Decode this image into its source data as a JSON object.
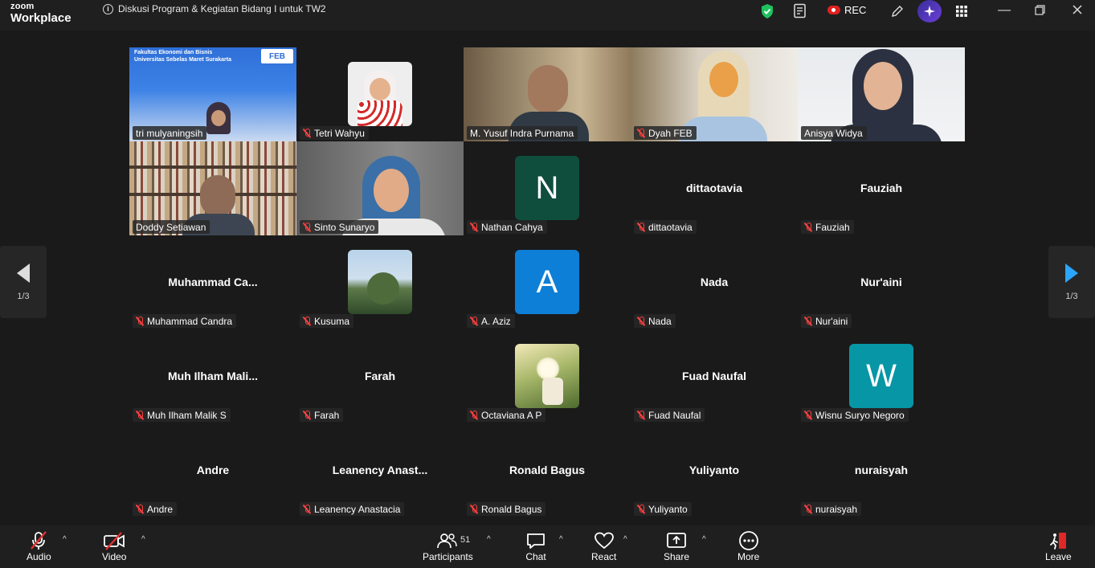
{
  "app": {
    "logo_line1": "zoom",
    "logo_line2": "Workplace"
  },
  "meeting": {
    "title": "Diskusi Program & Kegiatan Bidang I untuk TW2",
    "rec_label": "REC"
  },
  "pager": {
    "page": "1/3"
  },
  "feb_banner": {
    "line1": "Fakultas Ekonomi dan Bisnis",
    "line2": "Universitas Sebelas Maret Surakarta",
    "logo": "FEB"
  },
  "tiles": [
    {
      "name": "tri mulyaningsih",
      "kind": "video"
    },
    {
      "name": "Tetri Wahyu",
      "kind": "thumb"
    },
    {
      "name": "M. Yusuf Indra Purnama",
      "kind": "video"
    },
    {
      "name": "Dyah FEB",
      "kind": "video"
    },
    {
      "name": "Anisya Widya",
      "kind": "video"
    },
    {
      "name": "Doddy Setiawan",
      "kind": "video"
    },
    {
      "name": "Sinto Sunaryo",
      "kind": "video"
    },
    {
      "name": "Nathan Cahya",
      "kind": "avatar",
      "initial": "N",
      "color": "#0f4d3c"
    },
    {
      "name": "dittaotavia",
      "kind": "text",
      "display": "dittaotavia"
    },
    {
      "name": "Fauziah",
      "kind": "text",
      "display": "Fauziah"
    },
    {
      "name": "Muhammad Candra",
      "kind": "text",
      "display": "Muhammad  Ca..."
    },
    {
      "name": "Kusuma",
      "kind": "thumb"
    },
    {
      "name": "A. Aziz",
      "kind": "avatar",
      "initial": "A",
      "color": "#0e7fd6"
    },
    {
      "name": "Nada",
      "kind": "text",
      "display": "Nada"
    },
    {
      "name": "Nur'aini",
      "kind": "text",
      "display": "Nur'aini"
    },
    {
      "name": "Muh Ilham Malik S",
      "kind": "text",
      "display": "Muh  Ilham  Mali..."
    },
    {
      "name": "Farah",
      "kind": "text",
      "display": "Farah"
    },
    {
      "name": "Octaviana A P",
      "kind": "thumb"
    },
    {
      "name": "Fuad Naufal",
      "kind": "text",
      "display": "Fuad Naufal"
    },
    {
      "name": "Wisnu Suryo Negoro",
      "kind": "avatar",
      "initial": "W",
      "color": "#0796a6"
    },
    {
      "name": "Andre",
      "kind": "text",
      "display": "Andre"
    },
    {
      "name": "Leanency Anastacia",
      "kind": "text",
      "display": "Leanency  Anast..."
    },
    {
      "name": "Ronald Bagus",
      "kind": "text",
      "display": "Ronald Bagus"
    },
    {
      "name": "Yuliyanto",
      "kind": "text",
      "display": "Yuliyanto"
    },
    {
      "name": "nuraisyah",
      "kind": "text",
      "display": "nuraisyah"
    }
  ],
  "toolbar": {
    "audio": "Audio",
    "video": "Video",
    "participants": "Participants",
    "participant_count": "51",
    "chat": "Chat",
    "react": "React",
    "share": "Share",
    "more": "More",
    "leave": "Leave"
  },
  "colors": {
    "active_speaker": "#23d96f",
    "leave": "#e02828",
    "share_accent": "#ffffff"
  }
}
